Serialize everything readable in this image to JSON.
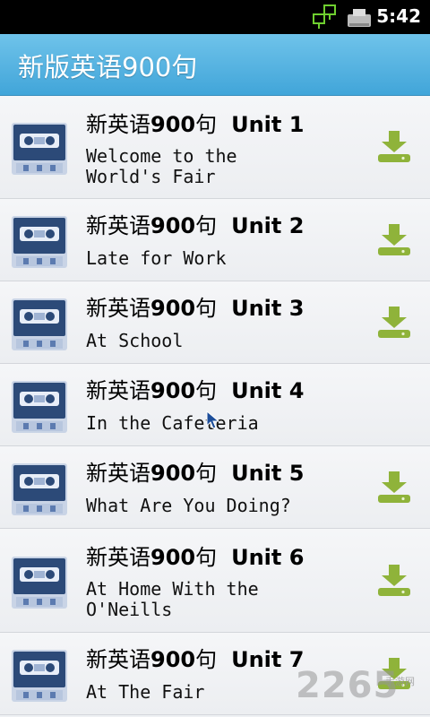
{
  "status_bar": {
    "time": "5:42",
    "icons": [
      "network-icon",
      "sd-card-icon"
    ]
  },
  "header": {
    "title": "新版英语900句"
  },
  "list": {
    "items": [
      {
        "cn": "新英语",
        "num": "900",
        "cn2": "句",
        "unit": "Unit 1",
        "subtitle": "Welcome to the\nWorld's Fair",
        "download": true
      },
      {
        "cn": "新英语",
        "num": "900",
        "cn2": "句",
        "unit": "Unit 2",
        "subtitle": "Late for Work",
        "download": true
      },
      {
        "cn": "新英语",
        "num": "900",
        "cn2": "句",
        "unit": "Unit 3",
        "subtitle": "At School",
        "download": true
      },
      {
        "cn": "新英语",
        "num": "900",
        "cn2": "句",
        "unit": "Unit 4",
        "subtitle": "In the Cafeteria",
        "download": false
      },
      {
        "cn": "新英语",
        "num": "900",
        "cn2": "句",
        "unit": "Unit 5",
        "subtitle": "What Are You Doing?",
        "download": true
      },
      {
        "cn": "新英语",
        "num": "900",
        "cn2": "句",
        "unit": "Unit 6",
        "subtitle": "At Home With the\nO'Neills",
        "download": true
      },
      {
        "cn": "新英语",
        "num": "900",
        "cn2": "句",
        "unit": "Unit 7",
        "subtitle": "At The Fair",
        "download": true
      }
    ]
  },
  "watermark": {
    "text": "2265",
    "sub": "手游网"
  },
  "colors": {
    "header": "#4aaede",
    "download_icon": "#8fb33a",
    "cassette": "#2c4a78"
  }
}
